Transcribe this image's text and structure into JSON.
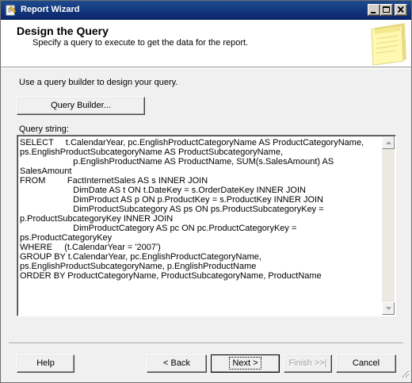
{
  "window": {
    "title": "Report Wizard"
  },
  "header": {
    "title": "Design the Query",
    "subtitle": "Specify a query to execute to get the data for the report."
  },
  "main": {
    "prompt": "Use a query builder to design your query.",
    "query_builder_label": "Query Builder...",
    "query_string_label": "Query string:",
    "query_string": "SELECT     t.CalendarYear, pc.EnglishProductCategoryName AS ProductCategoryName, \nps.EnglishProductSubcategoryName AS ProductSubcategoryName, \n                      p.EnglishProductName AS ProductName, SUM(s.SalesAmount) AS SalesAmount\nFROM         FactInternetSales AS s INNER JOIN\n                      DimDate AS t ON t.DateKey = s.OrderDateKey INNER JOIN\n                      DimProduct AS p ON p.ProductKey = s.ProductKey INNER JOIN\n                      DimProductSubcategory AS ps ON ps.ProductSubcategoryKey = \np.ProductSubcategoryKey INNER JOIN\n                      DimProductCategory AS pc ON pc.ProductCategoryKey = ps.ProductCategoryKey\nWHERE     (t.CalendarYear = '2007')\nGROUP BY t.CalendarYear, pc.EnglishProductCategoryName, \nps.EnglishProductSubcategoryName, p.EnglishProductName\nORDER BY ProductCategoryName, ProductSubcategoryName, ProductName"
  },
  "footer": {
    "help_label": "Help",
    "back_label": "< Back",
    "next_label": "Next >",
    "finish_label": "Finish >>|",
    "cancel_label": "Cancel"
  },
  "icons": {
    "app": "report-wizard-icon",
    "wizard": "notepad-icon",
    "minimize": "minimize-icon",
    "maximize": "maximize-icon",
    "close": "close-icon"
  },
  "colors": {
    "titlebar": "#0a246a",
    "dialog_bg": "#f0f0f0",
    "notepad": "#fff8b0"
  }
}
